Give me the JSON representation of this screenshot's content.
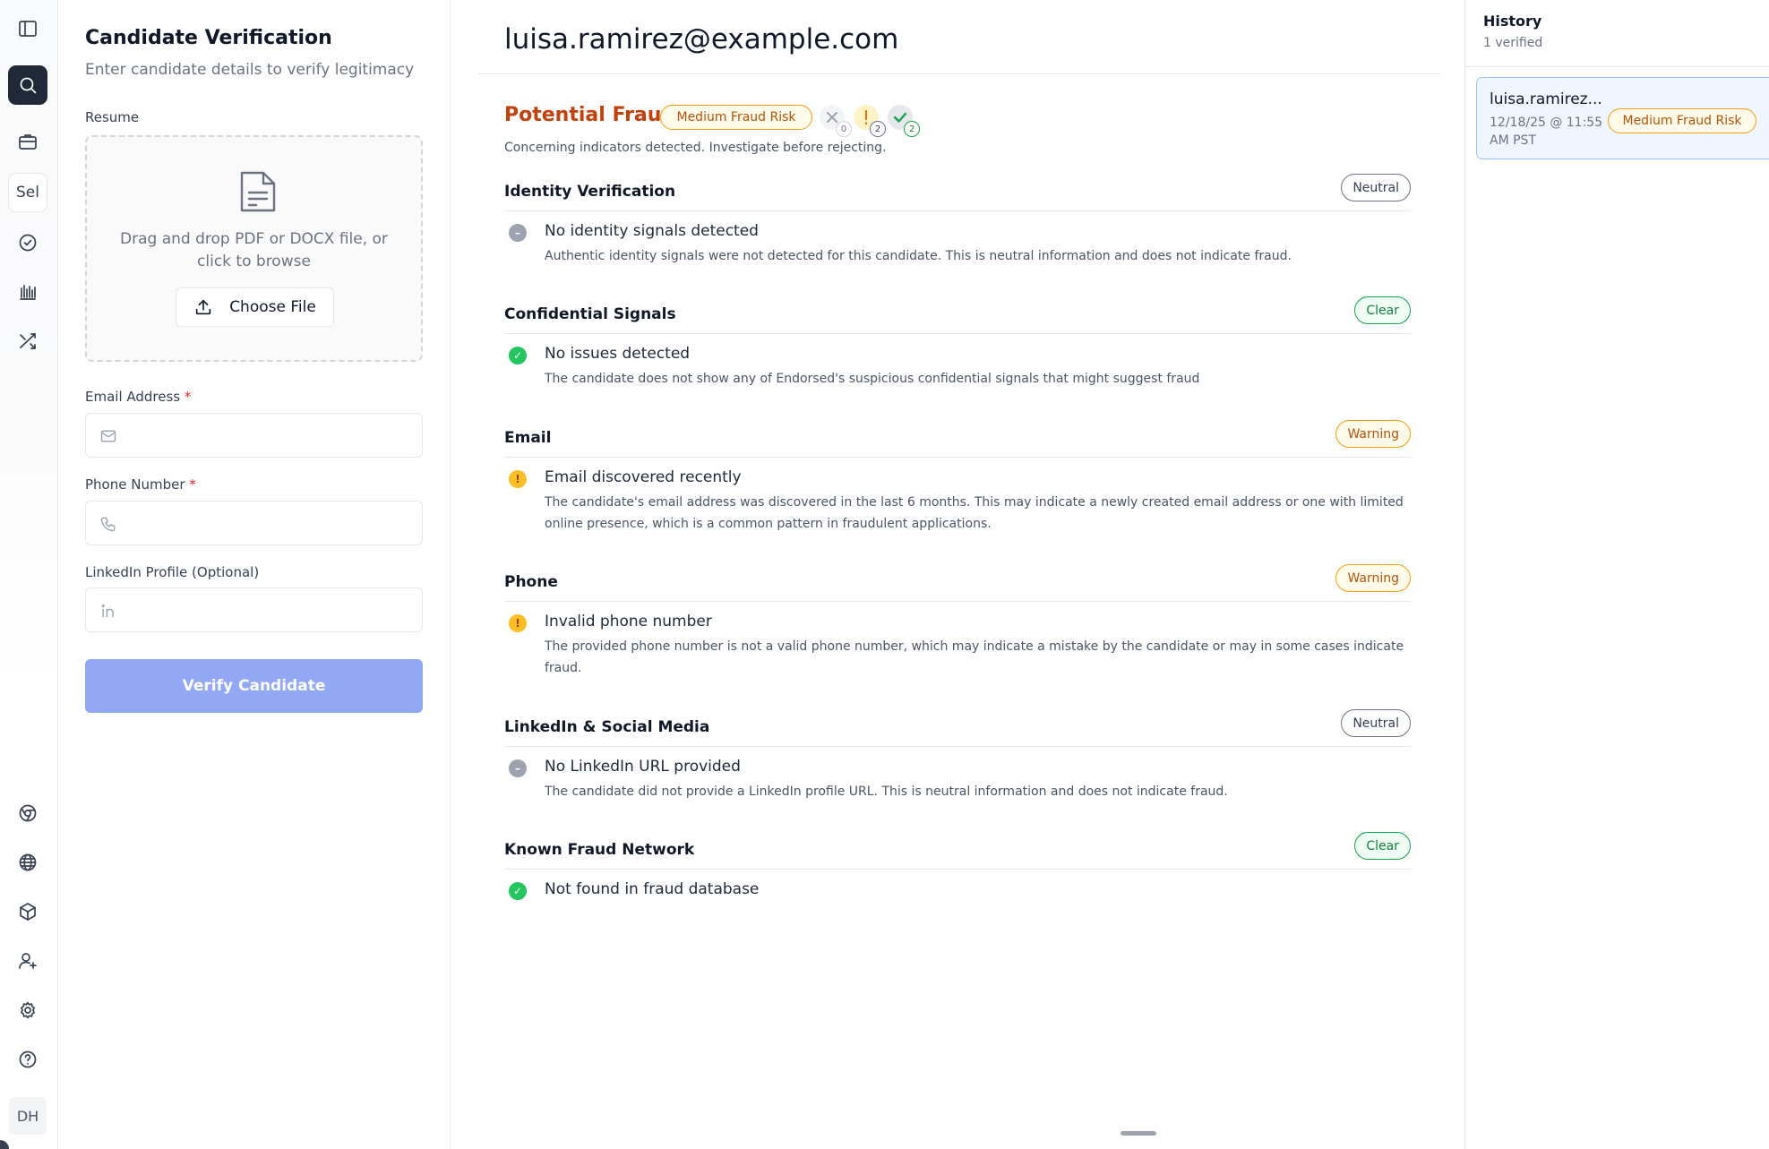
{
  "rail": {
    "items": [
      "sidebar-toggle",
      "search",
      "jobs",
      "Sel",
      "verify",
      "analytics",
      "shuffle"
    ],
    "bottom_items": [
      "chrome",
      "globe",
      "box",
      "add-user",
      "settings",
      "help"
    ],
    "select_label": "Sel",
    "avatar_initials": "DH"
  },
  "form": {
    "title": "Candidate Verification",
    "subtitle": "Enter candidate details to verify legitimacy",
    "resume_label": "Resume",
    "dropzone_text": "Drag and drop PDF or DOCX file, or click to browse",
    "choose_file_label": "Choose File",
    "email_label": "Email Address",
    "phone_label": "Phone Number",
    "linkedin_label": "LinkedIn Profile (Optional)",
    "required_mark": "*",
    "email_value": "",
    "phone_value": "",
    "linkedin_value": "",
    "verify_label": "Verify Candidate"
  },
  "result": {
    "email": "luisa.ramirez@example.com",
    "verdict": "Potential Fraud",
    "risk_label": "Medium Fraud Risk",
    "counts": {
      "fail": "0",
      "warning": "2",
      "pass": "2"
    },
    "verdict_desc": "Concerning indicators detected. Investigate before rejecting.",
    "sections": [
      {
        "title": "Identity Verification",
        "status": "Neutral",
        "item_title": "No identity signals detected",
        "item_desc": "Authentic identity signals were not detected for this candidate. This is neutral information and does not indicate fraud."
      },
      {
        "title": "Confidential Signals",
        "status": "Clear",
        "item_title": "No issues detected",
        "item_desc": "The candidate does not show any of Endorsed's suspicious confidential signals that might suggest fraud"
      },
      {
        "title": "Email",
        "status": "Warning",
        "item_title": "Email discovered recently",
        "item_desc": "The candidate's email address was discovered in the last 6 months. This may indicate a newly created email address or one with limited online presence, which is a common pattern in fraudulent applications."
      },
      {
        "title": "Phone",
        "status": "Warning",
        "item_title": "Invalid phone number",
        "item_desc": "The provided phone number is not a valid phone number, which may indicate a mistake by the candidate or may in some cases indicate fraud."
      },
      {
        "title": "LinkedIn & Social Media",
        "status": "Neutral",
        "item_title": "No LinkedIn URL provided",
        "item_desc": "The candidate did not provide a LinkedIn profile URL. This is neutral information and does not indicate fraud."
      },
      {
        "title": "Known Fraud Network",
        "status": "Clear",
        "item_title": "Not found in fraud database",
        "item_desc": ""
      }
    ]
  },
  "history": {
    "title": "History",
    "count": "1 verified",
    "entries": [
      {
        "email": "luisa.ramirez...",
        "date": "12/18/25 @ 11:55 AM PST",
        "risk": "Medium Fraud Risk"
      }
    ]
  },
  "colors": {
    "accent_dark": "#1f2937",
    "verify_button": "#93a8f4",
    "fraud_orange": "#c2410c",
    "clear_green": "#16a34a",
    "warning_amber": "#f59e0b"
  }
}
